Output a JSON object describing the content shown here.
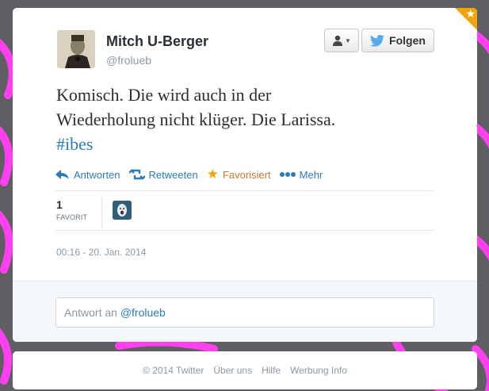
{
  "author": {
    "name": "Mitch U-Berger",
    "handle": "@froluеb"
  },
  "header": {
    "follow_label": "Folgen",
    "user_menu_icon": "person-dropdown-icon"
  },
  "tweet": {
    "text_line1": "Komisch. Die wird auch in der",
    "text_line2": "Wiederholung nicht klüger. Die Larissa.",
    "hashtag": "#ibes"
  },
  "actions": [
    {
      "label": "Antworten",
      "icon": "reply-icon"
    },
    {
      "label": "Retweeten",
      "icon": "retweet-icon"
    },
    {
      "label": "Favorisiert",
      "icon": "star-icon"
    },
    {
      "label": "Mehr",
      "icon": "more-icon"
    }
  ],
  "stats": {
    "favorites_count": "1",
    "favorites_label": "FAVORIT"
  },
  "timestamp": "00:16 - 20. Jan. 2014",
  "reply": {
    "prefix": "Antwort an ",
    "mention": "@froluеb"
  },
  "footer": {
    "copyright": "© 2014 Twitter",
    "links": [
      "Über uns",
      "Hilfe",
      "Werbung Info"
    ]
  },
  "colors": {
    "link": "#2b7bb9",
    "favorite": "#f0a60a",
    "background": "#5f5f63",
    "stripes": "#ff3ff0"
  }
}
